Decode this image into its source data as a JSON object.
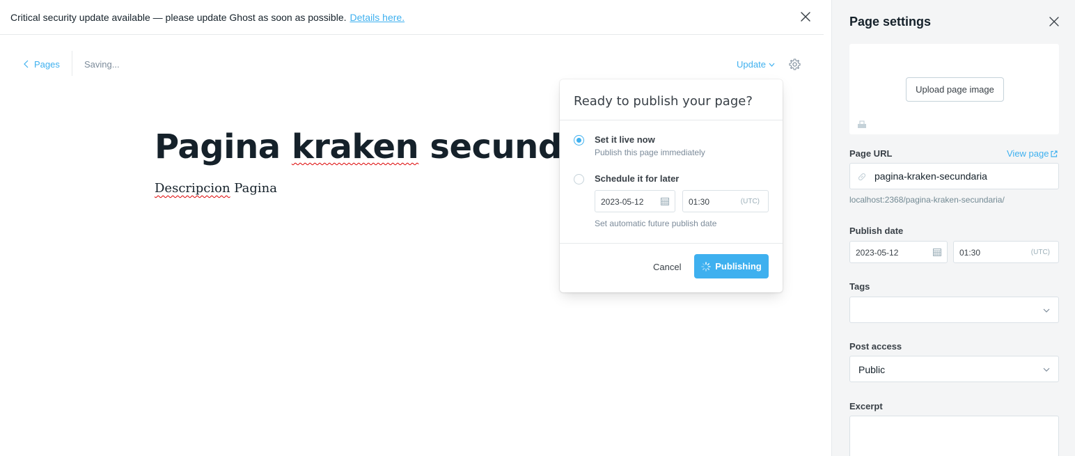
{
  "alert": {
    "message": "Critical security update available — please update Ghost as soon as possible.",
    "link": "Details here."
  },
  "editor": {
    "back_label": "Pages",
    "status": "Saving...",
    "update_label": "Update",
    "title_part1": "Pagina ",
    "title_part2": "kraken",
    "title_part3": " secundaria",
    "body_part1": "Descripcion",
    "body_part2": " Pagina"
  },
  "publish_menu": {
    "title": "Ready to publish your page?",
    "option_now_label": "Set it live now",
    "option_now_desc": "Publish this page immediately",
    "option_schedule_label": "Schedule it for later",
    "date": "2023-05-12",
    "time": "01:30",
    "timezone": "(UTC)",
    "schedule_hint": "Set automatic future publish date",
    "cancel_label": "Cancel",
    "publish_label": "Publishing"
  },
  "settings": {
    "title": "Page settings",
    "upload_label": "Upload page image",
    "url_label": "Page URL",
    "view_page_label": "View page",
    "url_value": "pagina-kraken-secundaria",
    "url_preview": "localhost:2368/pagina-kraken-secundaria/",
    "publish_date_label": "Publish date",
    "publish_date": "2023-05-12",
    "publish_time": "01:30",
    "timezone": "(UTC)",
    "tags_label": "Tags",
    "access_label": "Post access",
    "access_value": "Public",
    "excerpt_label": "Excerpt"
  },
  "colors": {
    "accent": "#3eb0ef",
    "text": "#15212a",
    "panel_bg": "#f4f5f6"
  },
  "icons": [
    "close-icon",
    "chevron-left-icon",
    "chevron-down-icon",
    "gear-icon",
    "calendar-icon",
    "spinner-icon",
    "image-icon",
    "link-icon",
    "external-link-icon"
  ]
}
